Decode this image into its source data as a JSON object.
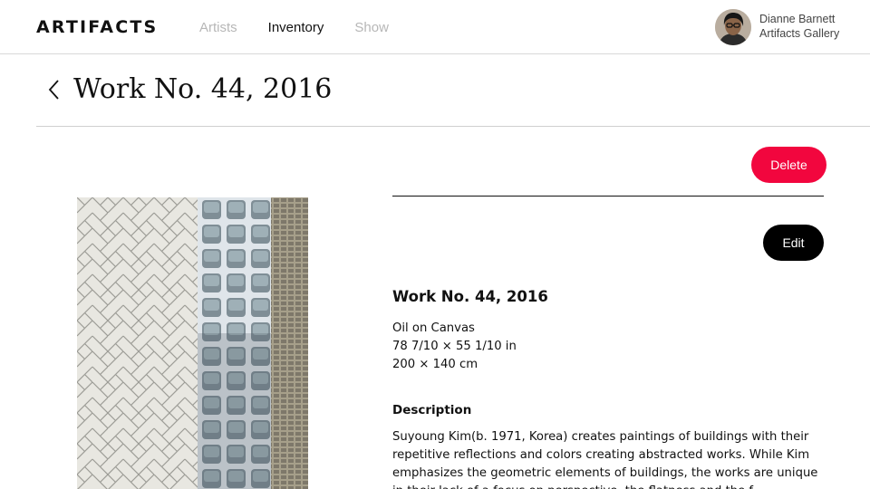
{
  "header": {
    "logo": "ARTIFACTS",
    "nav": [
      {
        "label": "Artists",
        "active": false
      },
      {
        "label": "Inventory",
        "active": true
      },
      {
        "label": "Show",
        "active": false
      }
    ],
    "user": {
      "name": "Dianne Barnett",
      "organization": "Artifacts Gallery"
    }
  },
  "page": {
    "title": "Work No. 44, 2016",
    "back_icon": "chevron-left-icon"
  },
  "actions": {
    "delete_label": "Delete",
    "edit_label": "Edit"
  },
  "artwork": {
    "title": "Work No. 44, 2016",
    "medium": "Oil on Canvas",
    "dimensions_in": "78 7/10 × 55 1/10 in",
    "dimensions_cm": "200 × 140 cm",
    "description_heading": "Description",
    "description": "Suyoung Kim(b. 1971, Korea) creates paintings of buildings with their repetitive reflections and colors creating abstracted works. While Kim emphasizes the geometric elements of buildings, the works are unique in their lack of a focus on perspective, the flatness and the f"
  },
  "colors": {
    "delete": "#f2063e",
    "edit": "#000000",
    "nav_inactive": "#b7b7b7",
    "nav_active": "#111111"
  }
}
